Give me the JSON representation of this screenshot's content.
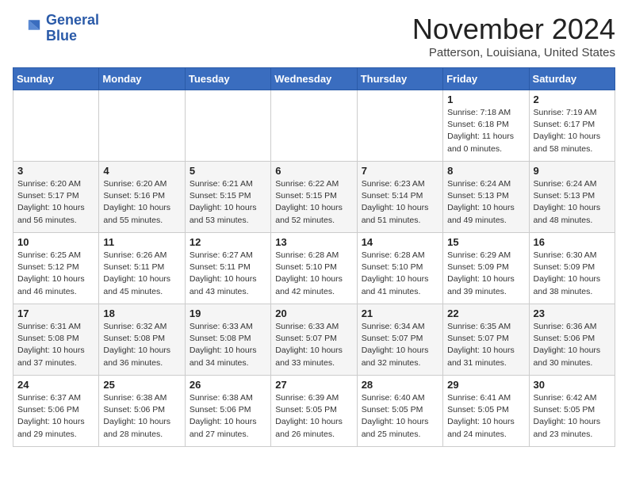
{
  "header": {
    "logo_line1": "General",
    "logo_line2": "Blue",
    "month": "November 2024",
    "location": "Patterson, Louisiana, United States"
  },
  "days_of_week": [
    "Sunday",
    "Monday",
    "Tuesday",
    "Wednesday",
    "Thursday",
    "Friday",
    "Saturday"
  ],
  "weeks": [
    [
      {
        "day": "",
        "info": ""
      },
      {
        "day": "",
        "info": ""
      },
      {
        "day": "",
        "info": ""
      },
      {
        "day": "",
        "info": ""
      },
      {
        "day": "",
        "info": ""
      },
      {
        "day": "1",
        "info": "Sunrise: 7:18 AM\nSunset: 6:18 PM\nDaylight: 11 hours\nand 0 minutes."
      },
      {
        "day": "2",
        "info": "Sunrise: 7:19 AM\nSunset: 6:17 PM\nDaylight: 10 hours\nand 58 minutes."
      }
    ],
    [
      {
        "day": "3",
        "info": "Sunrise: 6:20 AM\nSunset: 5:17 PM\nDaylight: 10 hours\nand 56 minutes."
      },
      {
        "day": "4",
        "info": "Sunrise: 6:20 AM\nSunset: 5:16 PM\nDaylight: 10 hours\nand 55 minutes."
      },
      {
        "day": "5",
        "info": "Sunrise: 6:21 AM\nSunset: 5:15 PM\nDaylight: 10 hours\nand 53 minutes."
      },
      {
        "day": "6",
        "info": "Sunrise: 6:22 AM\nSunset: 5:15 PM\nDaylight: 10 hours\nand 52 minutes."
      },
      {
        "day": "7",
        "info": "Sunrise: 6:23 AM\nSunset: 5:14 PM\nDaylight: 10 hours\nand 51 minutes."
      },
      {
        "day": "8",
        "info": "Sunrise: 6:24 AM\nSunset: 5:13 PM\nDaylight: 10 hours\nand 49 minutes."
      },
      {
        "day": "9",
        "info": "Sunrise: 6:24 AM\nSunset: 5:13 PM\nDaylight: 10 hours\nand 48 minutes."
      }
    ],
    [
      {
        "day": "10",
        "info": "Sunrise: 6:25 AM\nSunset: 5:12 PM\nDaylight: 10 hours\nand 46 minutes."
      },
      {
        "day": "11",
        "info": "Sunrise: 6:26 AM\nSunset: 5:11 PM\nDaylight: 10 hours\nand 45 minutes."
      },
      {
        "day": "12",
        "info": "Sunrise: 6:27 AM\nSunset: 5:11 PM\nDaylight: 10 hours\nand 43 minutes."
      },
      {
        "day": "13",
        "info": "Sunrise: 6:28 AM\nSunset: 5:10 PM\nDaylight: 10 hours\nand 42 minutes."
      },
      {
        "day": "14",
        "info": "Sunrise: 6:28 AM\nSunset: 5:10 PM\nDaylight: 10 hours\nand 41 minutes."
      },
      {
        "day": "15",
        "info": "Sunrise: 6:29 AM\nSunset: 5:09 PM\nDaylight: 10 hours\nand 39 minutes."
      },
      {
        "day": "16",
        "info": "Sunrise: 6:30 AM\nSunset: 5:09 PM\nDaylight: 10 hours\nand 38 minutes."
      }
    ],
    [
      {
        "day": "17",
        "info": "Sunrise: 6:31 AM\nSunset: 5:08 PM\nDaylight: 10 hours\nand 37 minutes."
      },
      {
        "day": "18",
        "info": "Sunrise: 6:32 AM\nSunset: 5:08 PM\nDaylight: 10 hours\nand 36 minutes."
      },
      {
        "day": "19",
        "info": "Sunrise: 6:33 AM\nSunset: 5:08 PM\nDaylight: 10 hours\nand 34 minutes."
      },
      {
        "day": "20",
        "info": "Sunrise: 6:33 AM\nSunset: 5:07 PM\nDaylight: 10 hours\nand 33 minutes."
      },
      {
        "day": "21",
        "info": "Sunrise: 6:34 AM\nSunset: 5:07 PM\nDaylight: 10 hours\nand 32 minutes."
      },
      {
        "day": "22",
        "info": "Sunrise: 6:35 AM\nSunset: 5:07 PM\nDaylight: 10 hours\nand 31 minutes."
      },
      {
        "day": "23",
        "info": "Sunrise: 6:36 AM\nSunset: 5:06 PM\nDaylight: 10 hours\nand 30 minutes."
      }
    ],
    [
      {
        "day": "24",
        "info": "Sunrise: 6:37 AM\nSunset: 5:06 PM\nDaylight: 10 hours\nand 29 minutes."
      },
      {
        "day": "25",
        "info": "Sunrise: 6:38 AM\nSunset: 5:06 PM\nDaylight: 10 hours\nand 28 minutes."
      },
      {
        "day": "26",
        "info": "Sunrise: 6:38 AM\nSunset: 5:06 PM\nDaylight: 10 hours\nand 27 minutes."
      },
      {
        "day": "27",
        "info": "Sunrise: 6:39 AM\nSunset: 5:05 PM\nDaylight: 10 hours\nand 26 minutes."
      },
      {
        "day": "28",
        "info": "Sunrise: 6:40 AM\nSunset: 5:05 PM\nDaylight: 10 hours\nand 25 minutes."
      },
      {
        "day": "29",
        "info": "Sunrise: 6:41 AM\nSunset: 5:05 PM\nDaylight: 10 hours\nand 24 minutes."
      },
      {
        "day": "30",
        "info": "Sunrise: 6:42 AM\nSunset: 5:05 PM\nDaylight: 10 hours\nand 23 minutes."
      }
    ]
  ]
}
